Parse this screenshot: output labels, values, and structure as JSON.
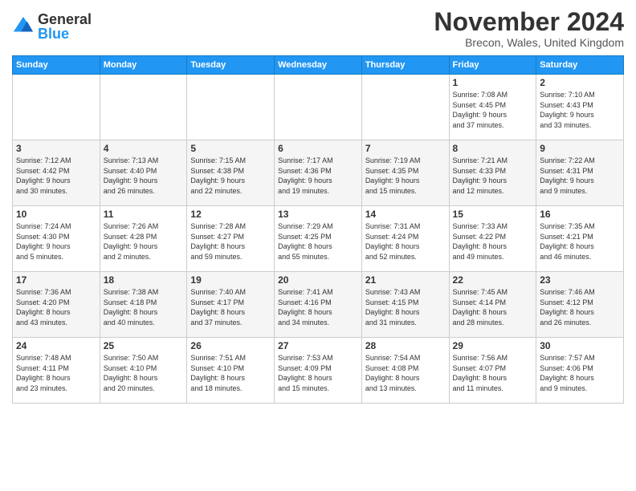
{
  "logo": {
    "general": "General",
    "blue": "Blue"
  },
  "header": {
    "month": "November 2024",
    "location": "Brecon, Wales, United Kingdom"
  },
  "weekdays": [
    "Sunday",
    "Monday",
    "Tuesday",
    "Wednesday",
    "Thursday",
    "Friday",
    "Saturday"
  ],
  "weeks": [
    [
      {
        "day": "",
        "info": ""
      },
      {
        "day": "",
        "info": ""
      },
      {
        "day": "",
        "info": ""
      },
      {
        "day": "",
        "info": ""
      },
      {
        "day": "",
        "info": ""
      },
      {
        "day": "1",
        "info": "Sunrise: 7:08 AM\nSunset: 4:45 PM\nDaylight: 9 hours\nand 37 minutes."
      },
      {
        "day": "2",
        "info": "Sunrise: 7:10 AM\nSunset: 4:43 PM\nDaylight: 9 hours\nand 33 minutes."
      }
    ],
    [
      {
        "day": "3",
        "info": "Sunrise: 7:12 AM\nSunset: 4:42 PM\nDaylight: 9 hours\nand 30 minutes."
      },
      {
        "day": "4",
        "info": "Sunrise: 7:13 AM\nSunset: 4:40 PM\nDaylight: 9 hours\nand 26 minutes."
      },
      {
        "day": "5",
        "info": "Sunrise: 7:15 AM\nSunset: 4:38 PM\nDaylight: 9 hours\nand 22 minutes."
      },
      {
        "day": "6",
        "info": "Sunrise: 7:17 AM\nSunset: 4:36 PM\nDaylight: 9 hours\nand 19 minutes."
      },
      {
        "day": "7",
        "info": "Sunrise: 7:19 AM\nSunset: 4:35 PM\nDaylight: 9 hours\nand 15 minutes."
      },
      {
        "day": "8",
        "info": "Sunrise: 7:21 AM\nSunset: 4:33 PM\nDaylight: 9 hours\nand 12 minutes."
      },
      {
        "day": "9",
        "info": "Sunrise: 7:22 AM\nSunset: 4:31 PM\nDaylight: 9 hours\nand 9 minutes."
      }
    ],
    [
      {
        "day": "10",
        "info": "Sunrise: 7:24 AM\nSunset: 4:30 PM\nDaylight: 9 hours\nand 5 minutes."
      },
      {
        "day": "11",
        "info": "Sunrise: 7:26 AM\nSunset: 4:28 PM\nDaylight: 9 hours\nand 2 minutes."
      },
      {
        "day": "12",
        "info": "Sunrise: 7:28 AM\nSunset: 4:27 PM\nDaylight: 8 hours\nand 59 minutes."
      },
      {
        "day": "13",
        "info": "Sunrise: 7:29 AM\nSunset: 4:25 PM\nDaylight: 8 hours\nand 55 minutes."
      },
      {
        "day": "14",
        "info": "Sunrise: 7:31 AM\nSunset: 4:24 PM\nDaylight: 8 hours\nand 52 minutes."
      },
      {
        "day": "15",
        "info": "Sunrise: 7:33 AM\nSunset: 4:22 PM\nDaylight: 8 hours\nand 49 minutes."
      },
      {
        "day": "16",
        "info": "Sunrise: 7:35 AM\nSunset: 4:21 PM\nDaylight: 8 hours\nand 46 minutes."
      }
    ],
    [
      {
        "day": "17",
        "info": "Sunrise: 7:36 AM\nSunset: 4:20 PM\nDaylight: 8 hours\nand 43 minutes."
      },
      {
        "day": "18",
        "info": "Sunrise: 7:38 AM\nSunset: 4:18 PM\nDaylight: 8 hours\nand 40 minutes."
      },
      {
        "day": "19",
        "info": "Sunrise: 7:40 AM\nSunset: 4:17 PM\nDaylight: 8 hours\nand 37 minutes."
      },
      {
        "day": "20",
        "info": "Sunrise: 7:41 AM\nSunset: 4:16 PM\nDaylight: 8 hours\nand 34 minutes."
      },
      {
        "day": "21",
        "info": "Sunrise: 7:43 AM\nSunset: 4:15 PM\nDaylight: 8 hours\nand 31 minutes."
      },
      {
        "day": "22",
        "info": "Sunrise: 7:45 AM\nSunset: 4:14 PM\nDaylight: 8 hours\nand 28 minutes."
      },
      {
        "day": "23",
        "info": "Sunrise: 7:46 AM\nSunset: 4:12 PM\nDaylight: 8 hours\nand 26 minutes."
      }
    ],
    [
      {
        "day": "24",
        "info": "Sunrise: 7:48 AM\nSunset: 4:11 PM\nDaylight: 8 hours\nand 23 minutes."
      },
      {
        "day": "25",
        "info": "Sunrise: 7:50 AM\nSunset: 4:10 PM\nDaylight: 8 hours\nand 20 minutes."
      },
      {
        "day": "26",
        "info": "Sunrise: 7:51 AM\nSunset: 4:10 PM\nDaylight: 8 hours\nand 18 minutes."
      },
      {
        "day": "27",
        "info": "Sunrise: 7:53 AM\nSunset: 4:09 PM\nDaylight: 8 hours\nand 15 minutes."
      },
      {
        "day": "28",
        "info": "Sunrise: 7:54 AM\nSunset: 4:08 PM\nDaylight: 8 hours\nand 13 minutes."
      },
      {
        "day": "29",
        "info": "Sunrise: 7:56 AM\nSunset: 4:07 PM\nDaylight: 8 hours\nand 11 minutes."
      },
      {
        "day": "30",
        "info": "Sunrise: 7:57 AM\nSunset: 4:06 PM\nDaylight: 8 hours\nand 9 minutes."
      }
    ]
  ]
}
